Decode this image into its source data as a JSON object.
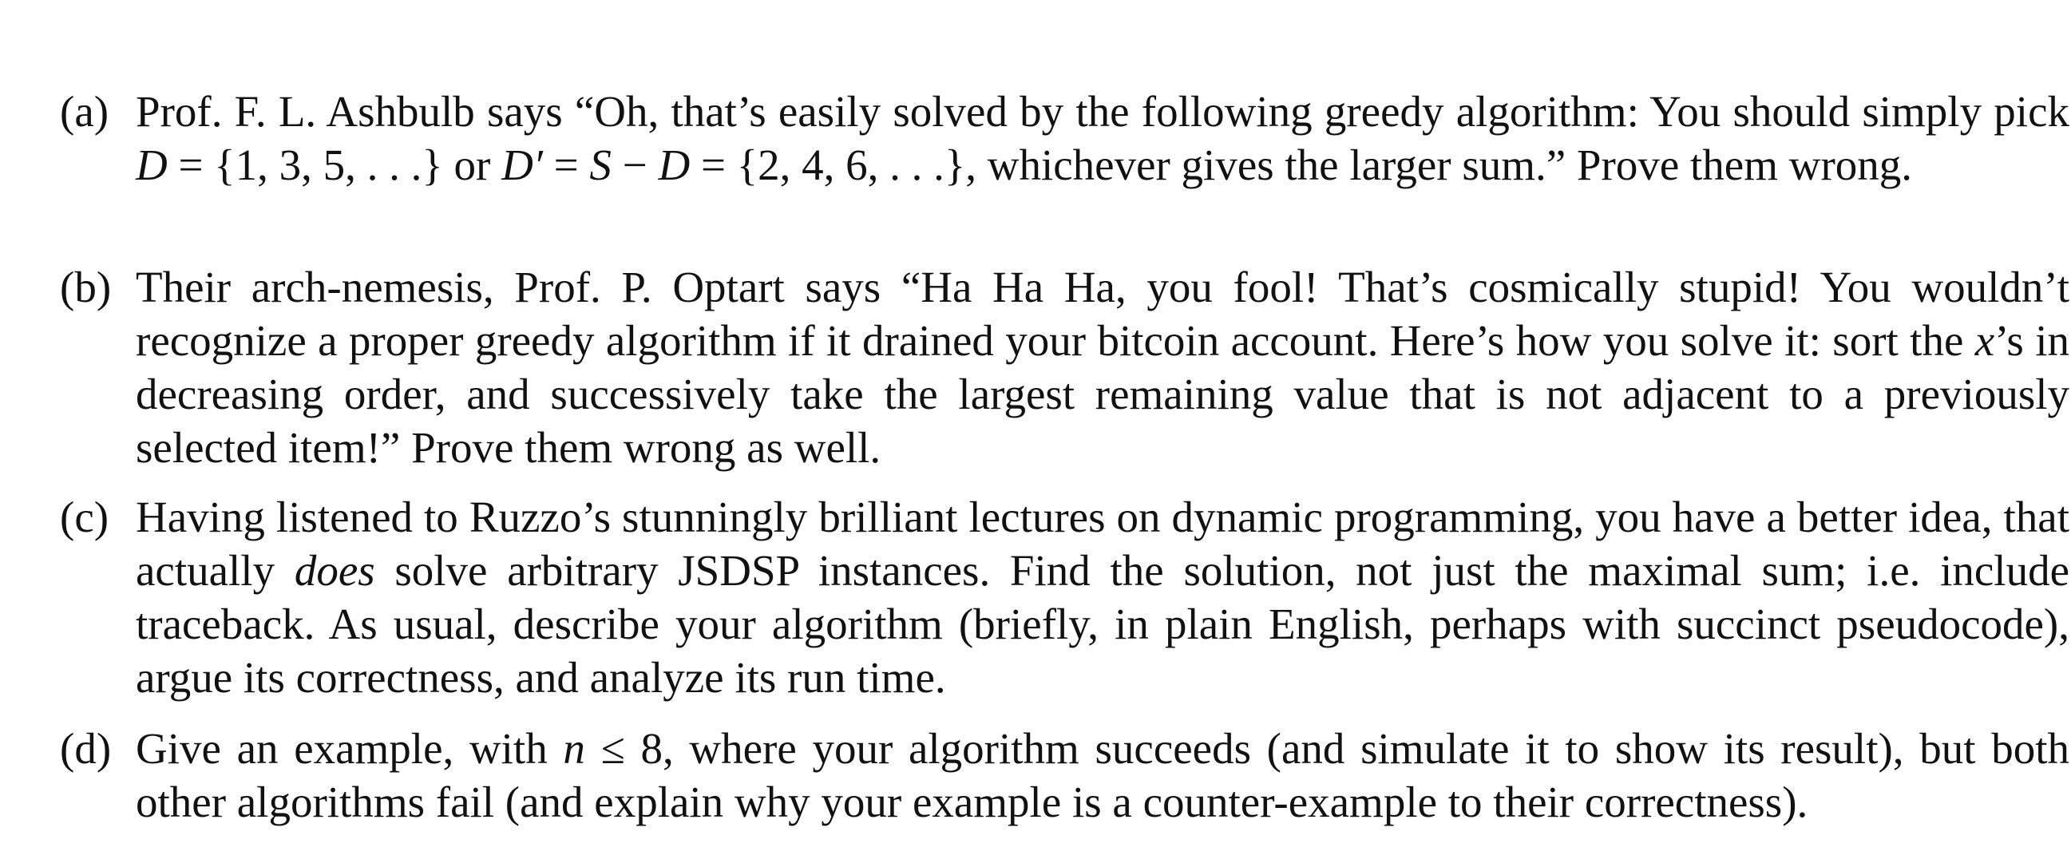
{
  "items": [
    {
      "marker": "(a)",
      "segments": [
        {
          "t": "Prof. F. L. Ashbulb says “Oh, that’s easily solved by the following greedy algorithm: You should simply pick "
        },
        {
          "t": "D",
          "math": true
        },
        {
          "t": " = {1, 3, 5, . . .} or "
        },
        {
          "t": "D′",
          "math": true
        },
        {
          "t": " = "
        },
        {
          "t": "S",
          "math": true
        },
        {
          "t": " − "
        },
        {
          "t": "D",
          "math": true
        },
        {
          "t": " = {2, 4, 6, . . .}, whichever gives the larger sum.” Prove them wrong."
        }
      ]
    },
    {
      "marker": "(b)",
      "segments": [
        {
          "t": "Their arch-nemesis, Prof. P. Optart says “Ha Ha Ha, you fool! That’s cosmically stupid! You wouldn’t recognize a proper greedy algorithm if it drained your bitcoin account. Here’s how you solve it: sort the "
        },
        {
          "t": "x",
          "math": true
        },
        {
          "t": "’s in decreasing order, and successively take the largest remaining value that is not adjacent to a previously selected item!” Prove them wrong as well."
        }
      ]
    },
    {
      "marker": "(c)",
      "segments": [
        {
          "t": "Having listened to Ruzzo’s stunningly brilliant lectures on dynamic programming, you have a better idea, that actually "
        },
        {
          "t": "does",
          "math": true
        },
        {
          "t": " solve arbitrary JSDSP instances. Find the solution, not just the maximal sum; i.e. include traceback. As usual, describe your algorithm (briefly, in plain English, perhaps with succinct pseudocode), argue its correctness, and analyze its run time."
        }
      ]
    },
    {
      "marker": "(d)",
      "segments": [
        {
          "t": "Give an example, with "
        },
        {
          "t": "n",
          "math": true
        },
        {
          "t": " ≤ 8, where your algorithm succeeds (and simulate it to show its result), but both other algorithms fail (and explain why your example is a counter-example to their correctness)."
        }
      ]
    }
  ]
}
